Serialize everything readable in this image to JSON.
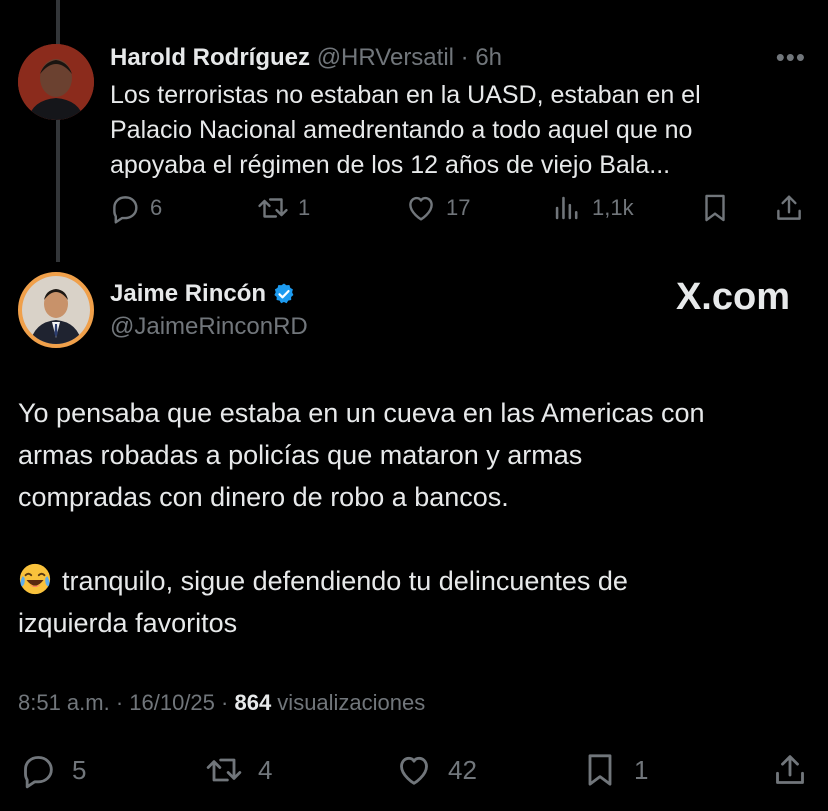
{
  "parent_tweet": {
    "author_name": "Harold Rodríguez",
    "meta": "@HRVersatil · 6h",
    "text_lines": [
      "Los terroristas no estaban en la UASD, estaban en el",
      "Palacio Nacional amedrentando a todo aquel que no",
      "apoyaba el régimen de los 12 años de viejo Bala..."
    ],
    "more_label": "•••",
    "actions": {
      "replies": "6",
      "reposts": "1",
      "likes": "17",
      "views": "1,1k"
    }
  },
  "main_tweet": {
    "author_name": "Jaime Rincón",
    "handle": "@JaimeRinconRD",
    "verified": true,
    "verified_color": "#1d9bf0",
    "watermark": "X.com",
    "text_paragraph1": [
      "Yo pensaba que estaba en un cueva en las Americas con",
      "armas robadas a policías que mataron y armas",
      "compradas con dinero de robo a bancos."
    ],
    "text_paragraph2_first": "tranquilo, sigue defendiendo tu delincuentes de",
    "text_paragraph2_second": "izquierda favoritos",
    "emoji": "laughing-crying-emoji",
    "timestamp": "8:51 a.m. · 16/10/25 · ",
    "views_count": "864",
    "views_label": " visualizaciones",
    "actions": {
      "replies": "5",
      "reposts": "4",
      "likes": "42",
      "bookmarks": "1"
    }
  },
  "colors": {
    "background": "#000000",
    "text_primary": "#e7e9ea",
    "text_secondary": "#71767b",
    "thread_line": "#333639"
  }
}
